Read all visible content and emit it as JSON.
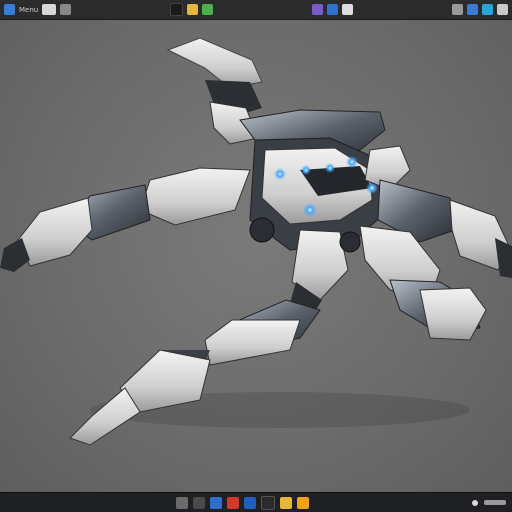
{
  "app": {
    "accent_color": "#3a7bd5"
  },
  "toolbar": {
    "left_label": "Menu",
    "icons": [
      "window-icon",
      "logo-icon",
      "arrow-icon",
      "dark-icon",
      "yellow-folder-icon",
      "green-icon",
      "purple-icon",
      "cube-icon",
      "globe-icon",
      "gear-icon",
      "app-icon",
      "square-icon",
      "gear2-icon"
    ]
  },
  "viewport": {
    "subject": "mech-robot-render"
  },
  "taskbar": {
    "icons": [
      "folder-icon",
      "window-icon",
      "blue-app-icon",
      "red-app-icon",
      "blue2-app-icon",
      "dark-app-icon",
      "yellow-folder-icon",
      "orange-app-icon"
    ],
    "tray": {
      "status": ""
    }
  }
}
